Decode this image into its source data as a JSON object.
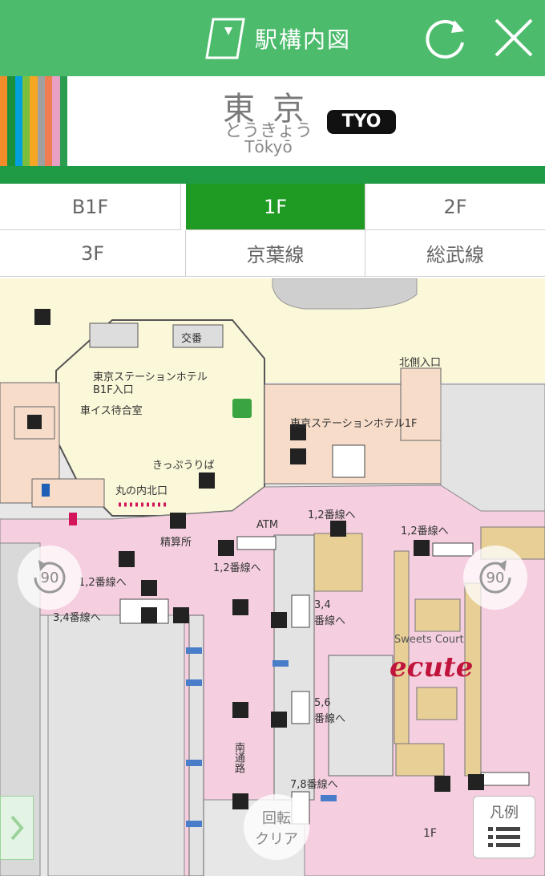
{
  "header": {
    "title": "駅構内図",
    "reload_icon": "refresh-icon",
    "close_icon": "close-icon"
  },
  "station": {
    "name_kanji": "東京",
    "name_kana": "とうきょう",
    "name_roman": "Tōkyō",
    "code": "TYO",
    "line_colors": [
      "#f28c28",
      "#1b8f3a",
      "#00a1de",
      "#7bbf3e",
      "#f5a623",
      "#a0a0a0",
      "#f07c52",
      "#e7a0c4",
      "#2a9d50"
    ]
  },
  "floor_tabs": [
    {
      "label": "B1F",
      "active": false
    },
    {
      "label": "1F",
      "active": true
    },
    {
      "label": "2F",
      "active": false
    },
    {
      "label": "3F",
      "active": false
    },
    {
      "label": "京葉線",
      "active": false
    },
    {
      "label": "総武線",
      "active": false
    }
  ],
  "map": {
    "labels": {
      "koban": "交番",
      "hotel_b1": "東京ステーションホテル",
      "hotel_b1_sub": "B1F入口",
      "wheelchair": "車イス待合室",
      "kippu": "きっぷうりば",
      "marunouchi_n": "丸の内北口",
      "minami": "北側入口",
      "hotel_1f": "東京ステーションホテル1F",
      "kaisatsu": "精算所",
      "atm": "ATM",
      "to12a": "1,2番線へ",
      "to12b": "1,2番線へ",
      "to12c": "1,2番線へ",
      "to12d": "1,2番線へ",
      "to34a": "3,4番線へ",
      "to34b": "3,4",
      "to34b2": "番線へ",
      "to56": "5,6",
      "to56_2": "番線へ",
      "to78": "7,8番線へ",
      "tsuro": "南通路",
      "sweets": "Sweets Court",
      "ecute": "ecute",
      "floor": "1F"
    },
    "rotate_left": "90",
    "rotate_right": "90",
    "clear_l1": "回転",
    "clear_l2": "クリア",
    "legend": "凡例"
  }
}
